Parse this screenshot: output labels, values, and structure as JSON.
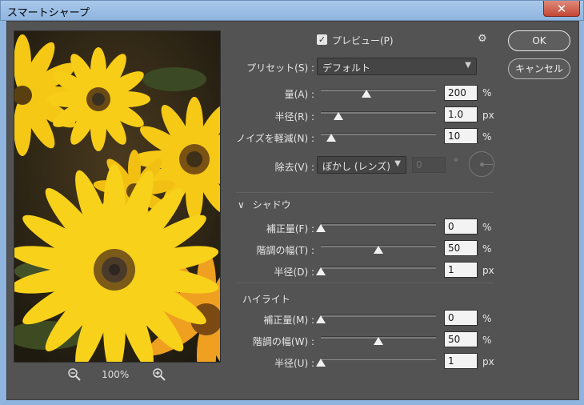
{
  "window": {
    "title": "スマートシャープ",
    "close_label": "✕"
  },
  "preview": {
    "zoom_level": "100%"
  },
  "header": {
    "preview_label": "プレビュー(P)",
    "preview_checked": true
  },
  "buttons": {
    "ok": "OK",
    "cancel": "キャンセル"
  },
  "preset": {
    "label": "プリセット(S) :",
    "value": "デフォルト"
  },
  "sharpen": {
    "amount": {
      "label": "量(A) :",
      "value": "200",
      "unit": "%"
    },
    "radius": {
      "label": "半径(R) :",
      "value": "1.0",
      "unit": "px"
    },
    "noise": {
      "label": "ノイズを軽減(N) :",
      "value": "10",
      "unit": "%"
    }
  },
  "remove": {
    "label": "除去(V) :",
    "value": "ぼかし (レンズ)",
    "angle_value": "0",
    "angle_unit": "°"
  },
  "shadow": {
    "title": "シャドウ",
    "fade": {
      "label": "補正量(F) :",
      "value": "0",
      "unit": "%"
    },
    "tonal": {
      "label": "階調の幅(T) :",
      "value": "50",
      "unit": "%"
    },
    "radius": {
      "label": "半径(D) :",
      "value": "1",
      "unit": "px"
    }
  },
  "highlight": {
    "title": "ハイライト",
    "fade": {
      "label": "補正量(M) :",
      "value": "0",
      "unit": "%"
    },
    "tonal": {
      "label": "階調の幅(W) :",
      "value": "50",
      "unit": "%"
    },
    "radius": {
      "label": "半径(U) :",
      "value": "1",
      "unit": "px"
    }
  },
  "colors": {
    "dialog_bg": "#535353",
    "field_bg": "#f3f3f3",
    "title_bar": "#a9c8ea",
    "close": "#c44634"
  }
}
